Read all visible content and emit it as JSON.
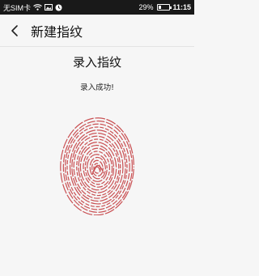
{
  "status_bar": {
    "carrier": "无SIM卡",
    "battery_percent": "29%",
    "battery_level": 0.29,
    "time": "11:15",
    "icons": [
      "wifi-icon",
      "image-icon",
      "clock-icon",
      "battery-icon"
    ]
  },
  "toolbar": {
    "title": "新建指纹",
    "back_icon": "chevron-left-icon"
  },
  "content": {
    "heading": "录入指纹",
    "status": "录入成功!"
  },
  "colors": {
    "fingerprint": "#c94f52",
    "status_bar_bg": "#191919",
    "page_bg": "#f6f6f6"
  }
}
